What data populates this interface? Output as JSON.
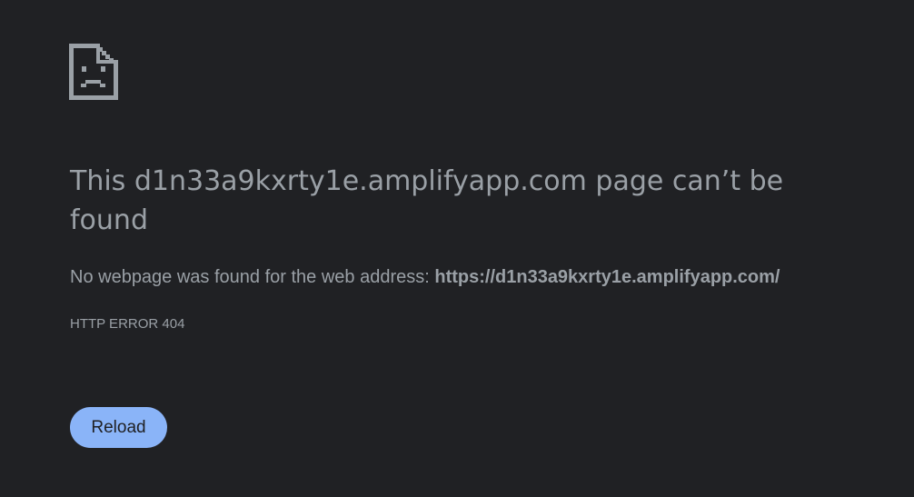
{
  "icon": {
    "name": "sad-document-icon"
  },
  "heading": {
    "prefix": "This ",
    "host": "d1n33a9kxrty1e.amplifyapp.com",
    "suffix": " page can’t be found"
  },
  "summary": {
    "text": "No webpage was found for the web address: ",
    "url": "https://d1n33a9kxrty1e.amplifyapp.com/"
  },
  "error_code": "HTTP ERROR 404",
  "reload_button": {
    "label": "Reload"
  },
  "colors": {
    "background": "#202124",
    "text": "#9aa0a6",
    "button": "#8ab4f8",
    "icon": "#9aa0a6"
  }
}
